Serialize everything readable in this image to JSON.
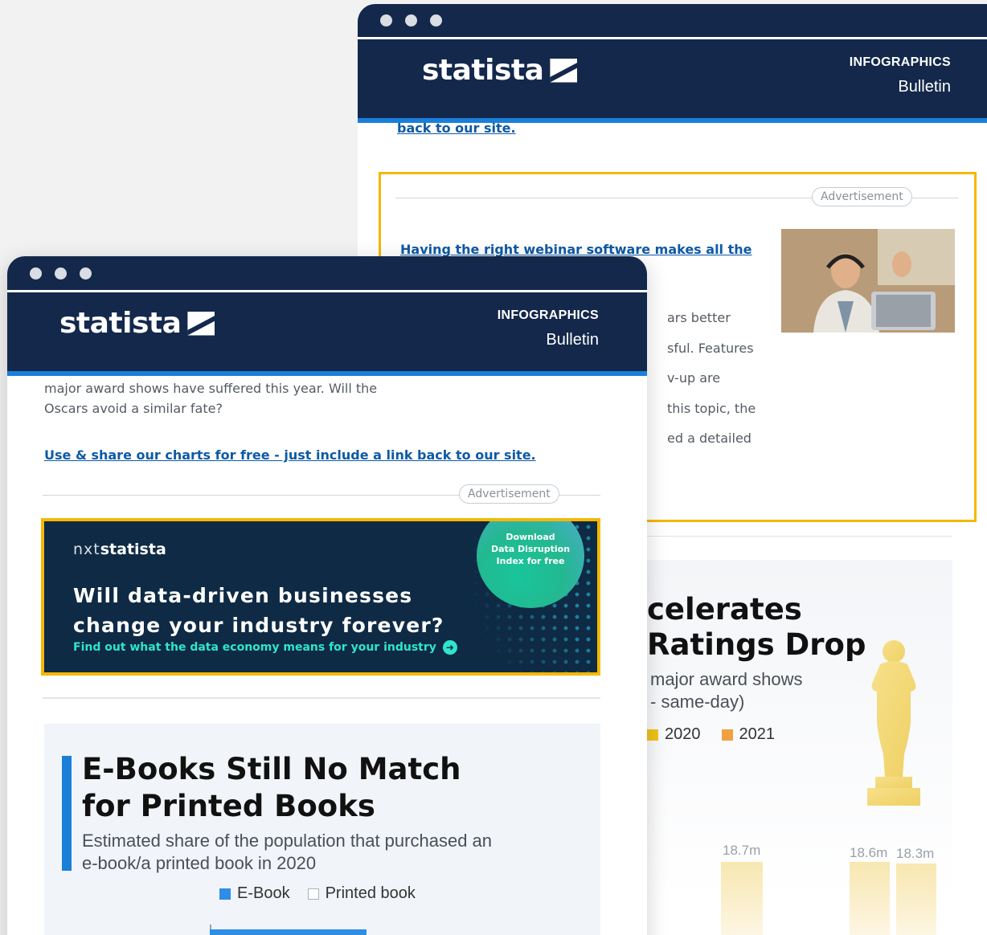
{
  "back_window": {
    "header": {
      "logo_text": "statista",
      "section_label": "INFOGRAPHICS",
      "section_sub": "Bulletin"
    },
    "link_text": "back to our site.",
    "ad": {
      "label": "Advertisement",
      "headline": "Having the right webinar software makes all the",
      "body_lines": [
        "ars better",
        "sful. Features",
        "v-up are",
        "this topic, the",
        "ed a detailed"
      ]
    },
    "chart": {
      "title_line1": "celerates",
      "title_line2": "Ratings Drop",
      "subtitle_line1": "major award shows",
      "subtitle_line2": "- same-day)",
      "legend": [
        "2020",
        "2021"
      ],
      "bar_labels": [
        "18.7m",
        "18.6m",
        "18.3m"
      ]
    }
  },
  "front_window": {
    "header": {
      "logo_text": "statista",
      "section_label": "INFOGRAPHICS",
      "section_sub": "Bulletin"
    },
    "intro_line1": "major award shows have suffered this year. Will the",
    "intro_line2": "Oscars avoid a similar fate?",
    "share_link": "Use & share our charts for free - just include a link back to our site.",
    "ad_label": "Advertisement",
    "banner": {
      "brand_prefix": "nxt",
      "brand_suffix": "statista",
      "badge_line1": "Download",
      "badge_line2": "Data Disruption",
      "badge_line3": "Index for free",
      "headline_line1": "Will data-driven businesses",
      "headline_line2": "change your industry forever?",
      "cta": "Find out what the data economy means for your industry"
    },
    "chart": {
      "title_line1": "E-Books Still No Match",
      "title_line2": "for Printed Books",
      "subtitle_line1": "Estimated share of the population that purchased an",
      "subtitle_line2": "e-book/a printed book in 2020",
      "legend": [
        "E-Book",
        "Printed book"
      ]
    }
  },
  "colors": {
    "navy": "#13284b",
    "accent_blue": "#1a7fd9",
    "link_blue": "#0e5aa6",
    "ad_highlight": "#f5b800",
    "gold_2020": "#f0c419",
    "orange_2021": "#f0a040"
  }
}
